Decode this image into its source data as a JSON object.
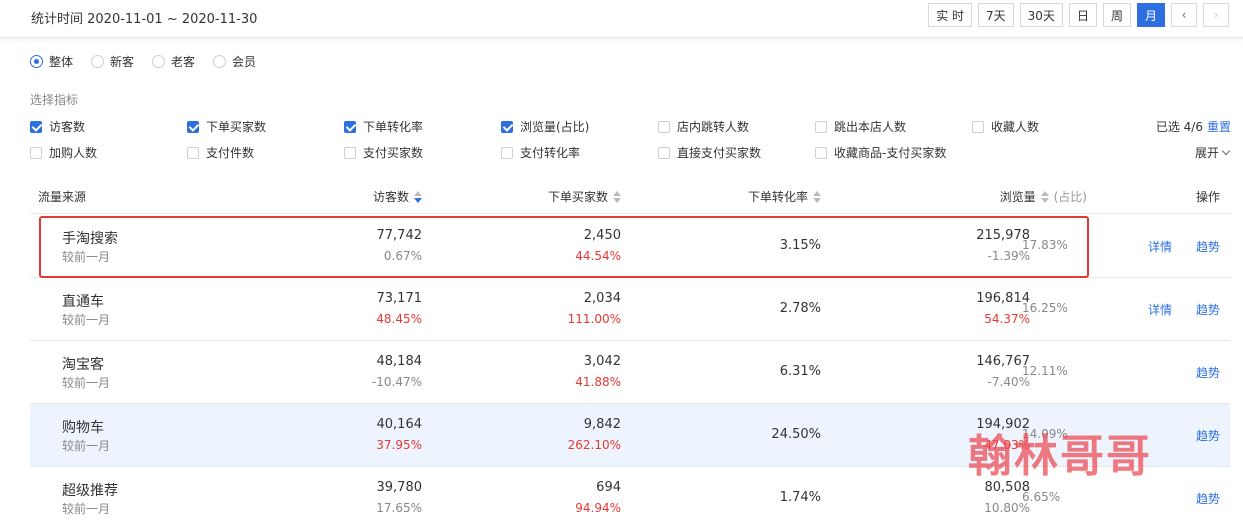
{
  "header": {
    "date_range": "统计时间 2020-11-01 ~ 2020-11-30",
    "time_buttons": [
      "实 时",
      "7天",
      "30天",
      "日",
      "周",
      "月"
    ],
    "active": "月"
  },
  "segments": {
    "options": [
      "整体",
      "新客",
      "老客",
      "会员"
    ],
    "selected": "整体"
  },
  "metrics": {
    "title": "选择指标",
    "row1": [
      {
        "label": "访客数",
        "checked": true
      },
      {
        "label": "下单买家数",
        "checked": true
      },
      {
        "label": "下单转化率",
        "checked": true
      },
      {
        "label": "浏览量(占比)",
        "checked": true
      },
      {
        "label": "店内跳转人数",
        "checked": false
      },
      {
        "label": "跳出本店人数",
        "checked": false
      },
      {
        "label": "收藏人数",
        "checked": false
      }
    ],
    "row2": [
      {
        "label": "加购人数",
        "checked": false
      },
      {
        "label": "支付件数",
        "checked": false
      },
      {
        "label": "支付买家数",
        "checked": false
      },
      {
        "label": "支付转化率",
        "checked": false
      },
      {
        "label": "直接支付买家数",
        "checked": false
      },
      {
        "label": "收藏商品-支付买家数",
        "checked": false
      }
    ],
    "selected_count": "已选 4/6",
    "reset": "重置",
    "expand": "展开"
  },
  "table": {
    "headers": {
      "source": "流量来源",
      "visitors": "访客数",
      "buyers": "下单买家数",
      "conversion": "下单转化率",
      "pageviews": "浏览量",
      "share": "(占比)",
      "actions": "操作"
    },
    "compare_label": "较前一月",
    "detail_label": "详情",
    "trend_label": "趋势",
    "rows": [
      {
        "name": "手淘搜索",
        "visitors": "77,742",
        "visitors_change": "0.67%",
        "visitors_sign": "normal",
        "buyers": "2,450",
        "buyers_change": "44.54%",
        "buyers_sign": "pos",
        "conversion": "3.15%",
        "pageviews": "215,978",
        "pageviews_change": "-1.39%",
        "pageviews_sign": "neg",
        "share": "17.83%",
        "detail": true
      },
      {
        "name": "直通车",
        "visitors": "73,171",
        "visitors_change": "48.45%",
        "visitors_sign": "pos",
        "buyers": "2,034",
        "buyers_change": "111.00%",
        "buyers_sign": "pos",
        "conversion": "2.78%",
        "pageviews": "196,814",
        "pageviews_change": "54.37%",
        "pageviews_sign": "pos",
        "share": "16.25%",
        "detail": true
      },
      {
        "name": "淘宝客",
        "visitors": "48,184",
        "visitors_change": "-10.47%",
        "visitors_sign": "neg",
        "buyers": "3,042",
        "buyers_change": "41.88%",
        "buyers_sign": "pos",
        "conversion": "6.31%",
        "pageviews": "146,767",
        "pageviews_change": "-7.40%",
        "pageviews_sign": "neg",
        "share": "12.11%",
        "detail": false
      },
      {
        "name": "购物车",
        "visitors": "40,164",
        "visitors_change": "37.95%",
        "visitors_sign": "pos",
        "buyers": "9,842",
        "buyers_change": "262.10%",
        "buyers_sign": "pos",
        "conversion": "24.50%",
        "pageviews": "194,902",
        "pageviews_change": "47.03%",
        "pageviews_sign": "pos",
        "share": "14.09%",
        "detail": false
      },
      {
        "name": "超级推荐",
        "visitors": "39,780",
        "visitors_change": "17.65%",
        "visitors_sign": "normal",
        "buyers": "694",
        "buyers_change": "94.94%",
        "buyers_sign": "pos",
        "conversion": "1.74%",
        "pageviews": "80,508",
        "pageviews_change": "10.80%",
        "pageviews_sign": "normal",
        "share": "6.65%",
        "detail": false
      }
    ]
  },
  "watermark": "翰林哥哥"
}
